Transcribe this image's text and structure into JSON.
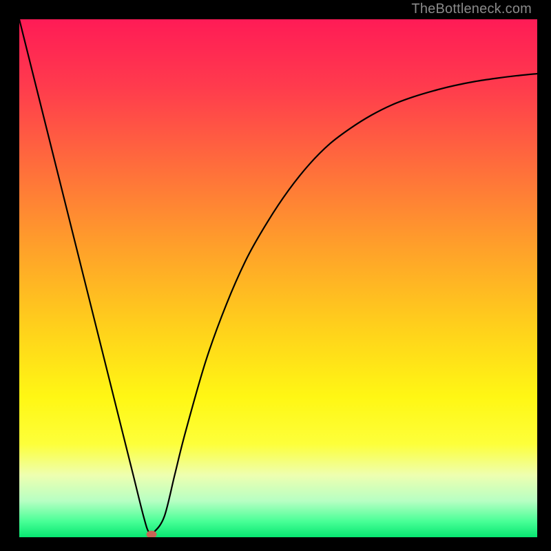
{
  "watermark": "TheBottleneck.com",
  "chart_data": {
    "type": "line",
    "title": "",
    "xlabel": "",
    "ylabel": "",
    "xlim": [
      0,
      100
    ],
    "ylim": [
      0,
      100
    ],
    "grid": false,
    "legend": false,
    "series": [
      {
        "name": "curve",
        "x": [
          0,
          4,
          8,
          12,
          16,
          20,
          22,
          24,
          25,
          26,
          28,
          30,
          32,
          36,
          40,
          44,
          48,
          52,
          56,
          60,
          64,
          68,
          72,
          76,
          80,
          84,
          88,
          92,
          96,
          100
        ],
        "y": [
          100,
          84,
          68,
          52,
          36,
          20,
          12,
          4,
          1,
          1,
          4,
          12,
          20,
          34,
          45,
          54,
          61,
          67,
          72,
          76,
          79,
          81.5,
          83.5,
          85,
          86.2,
          87.2,
          88,
          88.6,
          89.1,
          89.5
        ]
      }
    ],
    "marker": {
      "x": 25.5,
      "y": 0.5,
      "color": "#c86455"
    },
    "gradient_stops": [
      {
        "pos": 0.0,
        "color": "#ff1b56"
      },
      {
        "pos": 0.13,
        "color": "#ff3b4d"
      },
      {
        "pos": 0.28,
        "color": "#ff6c3c"
      },
      {
        "pos": 0.44,
        "color": "#ffa02a"
      },
      {
        "pos": 0.6,
        "color": "#ffd21b"
      },
      {
        "pos": 0.73,
        "color": "#fff714"
      },
      {
        "pos": 0.82,
        "color": "#fdff3a"
      },
      {
        "pos": 0.88,
        "color": "#eeffb0"
      },
      {
        "pos": 0.93,
        "color": "#b7ffc3"
      },
      {
        "pos": 0.97,
        "color": "#47ff96"
      },
      {
        "pos": 1.0,
        "color": "#07e671"
      }
    ]
  }
}
